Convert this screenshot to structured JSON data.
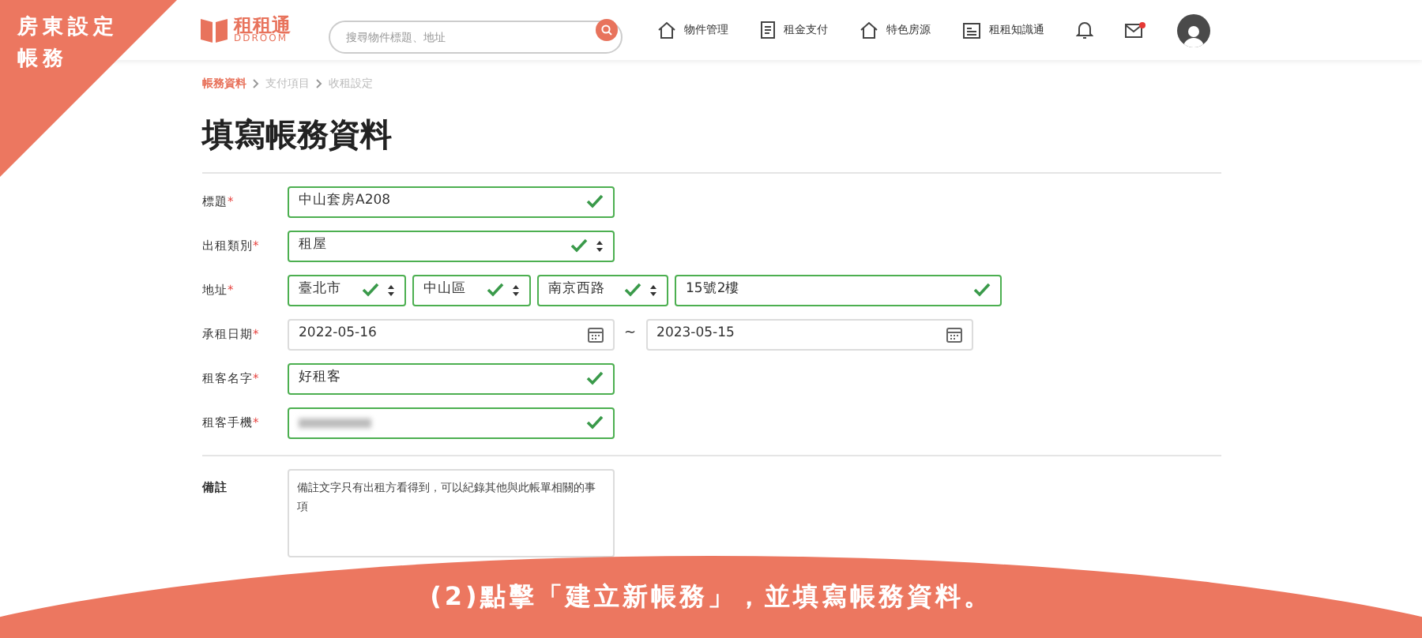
{
  "corner_banner": {
    "lines": [
      "房東設定",
      "帳務"
    ]
  },
  "header": {
    "logo": {
      "name": "租租通",
      "sub": "DDROOM"
    },
    "search": {
      "placeholder": "搜尋物件標題、地址"
    },
    "nav": [
      {
        "label": "物件管理"
      },
      {
        "label": "租金支付"
      },
      {
        "label": "特色房源"
      },
      {
        "label": "租租知識通"
      }
    ],
    "mail_unread": true
  },
  "breadcrumb": [
    {
      "label": "帳務資料",
      "selected": true
    },
    {
      "label": "支付項目",
      "selected": false
    },
    {
      "label": "收租設定",
      "selected": false
    }
  ],
  "page_title": "填寫帳務資料",
  "required_mark": "*",
  "form": [
    {
      "label": "標題",
      "required": true,
      "fields": [
        {
          "kind": "text",
          "value": "中山套房A208",
          "valid": true
        }
      ]
    },
    {
      "label": "出租類別",
      "required": true,
      "fields": [
        {
          "kind": "select",
          "value": "租屋",
          "valid": true
        }
      ]
    },
    {
      "label": "地址",
      "required": true,
      "fields": [
        {
          "kind": "select",
          "value": "臺北市",
          "valid": true
        },
        {
          "kind": "select",
          "value": "中山區",
          "valid": true
        },
        {
          "kind": "select",
          "value": "南京西路",
          "valid": true
        },
        {
          "kind": "text",
          "value": "15號2樓",
          "valid": true
        }
      ]
    },
    {
      "label": "承租日期",
      "required": true,
      "separator": "~",
      "fields": [
        {
          "kind": "date",
          "value": "2022-05-16",
          "valid": false
        },
        {
          "kind": "date",
          "value": "2023-05-15",
          "valid": false
        }
      ]
    },
    {
      "label": "租客名字",
      "required": true,
      "fields": [
        {
          "kind": "text",
          "value": "好租客",
          "valid": true
        }
      ]
    },
    {
      "label": "租客手機",
      "required": true,
      "fields": [
        {
          "kind": "blurred",
          "valid": true
        }
      ]
    }
  ],
  "remarks": {
    "label": "備註",
    "placeholder": "備註文字只有出租方看得到，可以紀錄其他與此帳單相關的事項"
  },
  "caption": "(2)點擊「建立新帳務」，並填寫帳務資料。"
}
